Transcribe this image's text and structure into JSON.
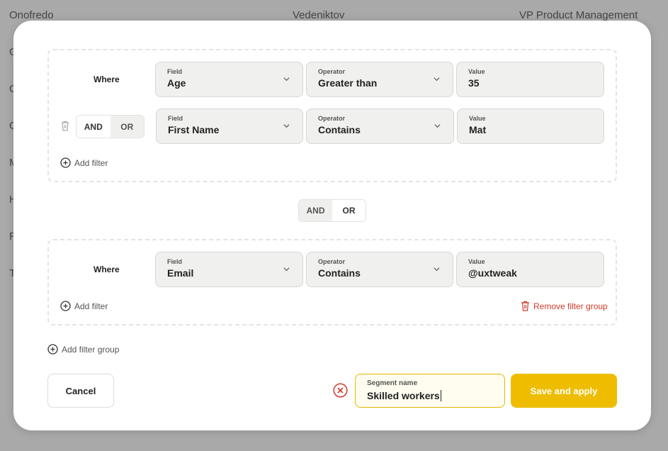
{
  "background_table": {
    "first_row": [
      "Onofredo",
      "Vedeniktov",
      "VP Product Management"
    ],
    "partial_rows": [
      "G",
      "G",
      "G",
      "M",
      "H",
      "R",
      "T"
    ]
  },
  "groups": [
    {
      "where_label": "Where",
      "filters": [
        {
          "field_label": "Field",
          "field_value": "Age",
          "operator_label": "Operator",
          "operator_value": "Greater than",
          "value_label": "Value",
          "value_value": "35"
        },
        {
          "field_label": "Field",
          "field_value": "First Name",
          "operator_label": "Operator",
          "operator_value": "Contains",
          "value_label": "Value",
          "value_value": "Mat"
        }
      ],
      "toggle": {
        "and_label": "AND",
        "or_label": "OR",
        "selected": "AND"
      },
      "add_filter_label": "Add filter"
    },
    {
      "where_label": "Where",
      "filters": [
        {
          "field_label": "Field",
          "field_value": "Email",
          "operator_label": "Operator",
          "operator_value": "Contains",
          "value_label": "Value",
          "value_value": "@uxtweak"
        }
      ],
      "add_filter_label": "Add filter",
      "remove_group_label": "Remove filter group"
    }
  ],
  "group_toggle": {
    "and_label": "AND",
    "or_label": "OR",
    "selected": "OR"
  },
  "add_group_label": "Add filter group",
  "footer": {
    "cancel_label": "Cancel",
    "segment_label": "Segment name",
    "segment_value": "Skilled workers",
    "save_label": "Save and apply"
  },
  "colors": {
    "accent": "#eebd00",
    "danger": "#d23b2a",
    "field_bg": "#f0f0ee"
  }
}
